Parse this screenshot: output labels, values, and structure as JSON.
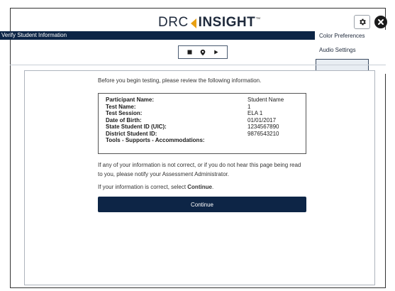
{
  "header": {
    "logo_text_left": "DRC",
    "logo_text_right": "INSIGHT",
    "logo_tm": "™",
    "gear_icon": "gear-icon",
    "close_icon": "close-icon"
  },
  "titlebar": {
    "title": "Verify Student Information"
  },
  "settings_menu": {
    "items": [
      "Color Preferences",
      "Audio Settings",
      ""
    ]
  },
  "toolbar": {
    "icons": [
      "stop-icon",
      "location-pin-icon",
      "play-icon"
    ]
  },
  "content": {
    "intro": "Before you begin testing, please review the following information.",
    "info": [
      {
        "label": "Participant Name:",
        "value": "Student Name"
      },
      {
        "label": "Test Name:",
        "value": "1"
      },
      {
        "label": "Test Session:",
        "value": "ELA 1"
      },
      {
        "label": "Date of Birth:",
        "value": "01/01/2017"
      },
      {
        "label": "State Student ID (UIC):",
        "value": "1234567890"
      },
      {
        "label": "District Student ID:",
        "value": "9876543210"
      },
      {
        "label": "Tools - Supports - Accommodations:",
        "value": ""
      }
    ],
    "note_line1": "If any of your information is not correct, or if you do not hear this page being read",
    "note_line2": "to you, please notify your Assessment Administrator.",
    "confirm_prefix": "If your information is correct, select ",
    "confirm_action": "Continue",
    "confirm_suffix": ".",
    "continue_label": "Continue"
  },
  "colors": {
    "navy": "#0d2546",
    "accent_orange": "#e8a013"
  }
}
